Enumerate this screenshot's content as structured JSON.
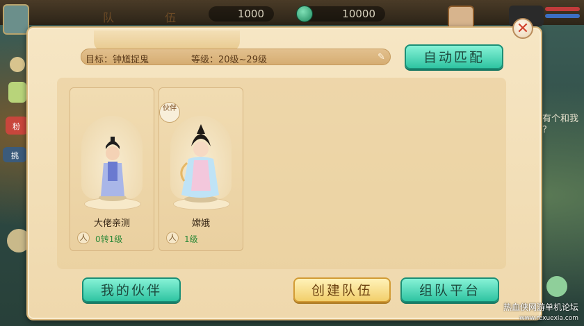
{
  "topbar": {
    "currency_1": "1000",
    "currency_2": "10000"
  },
  "panel": {
    "title": "队 伍",
    "close": "✕",
    "target_label": "目标：钟馗捉鬼",
    "level_label": "等级：20级~29级",
    "auto_match": "自动匹配"
  },
  "members": [
    {
      "name": "大佬亲测",
      "level": "0转1级",
      "level_icon": "人"
    },
    {
      "name": "嫦娥",
      "level": "1级",
      "level_icon": "人",
      "badge": "伙伴"
    }
  ],
  "buttons": {
    "my_partners": "我的伙伴",
    "create_team": "创建队伍",
    "team_platform": "组队平台"
  },
  "background_text": {
    "right_hint_1": "有个和我",
    "right_hint_2": "?",
    "left_label_1": "挑",
    "left_label_2": "粉"
  },
  "watermark": {
    "line1": "热血侠网游单机论坛",
    "line2": "www.rexuexia.com"
  },
  "colors": {
    "accent_teal": "#2fc4a2",
    "accent_gold": "#f2cf6c",
    "panel_bg": "#f6e6c4",
    "close_red": "#d2422d"
  }
}
